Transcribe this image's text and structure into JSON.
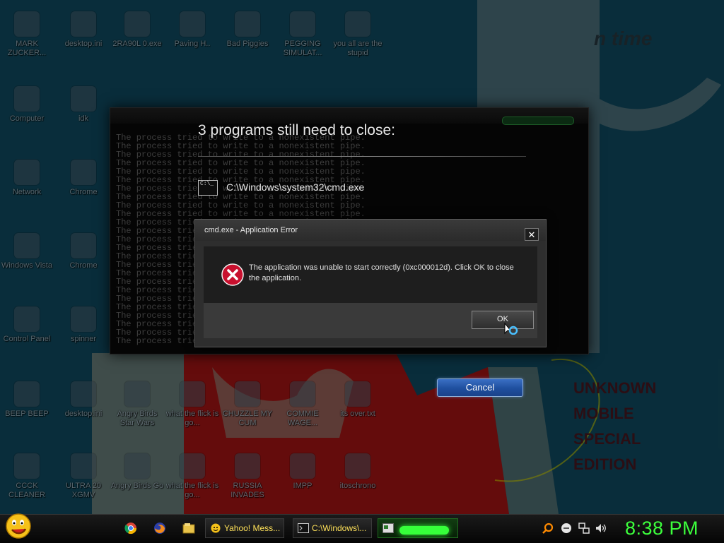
{
  "shutdown": {
    "headline": "3 programs still need to close:",
    "program_name": "C:\\Windows\\system32\\cmd.exe",
    "program_icon_text": "C:\\_",
    "cancel_label": "Cancel"
  },
  "error_dialog": {
    "title": "cmd.exe - Application Error",
    "close_glyph": "✕",
    "message": "The application was unable to start correctly (0xc000012d). Click OK to close the application.",
    "ok_label": "OK",
    "icon": "error-icon"
  },
  "wallpaper": {
    "time_text": "n time",
    "red_caption_lines": [
      "UNKNOWN",
      "MOBILE",
      "SPECIAL",
      "EDITION"
    ]
  },
  "desktop_icons": [
    {
      "label": "MARK ZUCKER..."
    },
    {
      "label": "desktop.ini"
    },
    {
      "label": "2RA90L 0.exe"
    },
    {
      "label": "Paving H.."
    },
    {
      "label": "Bad Piggies"
    },
    {
      "label": "PEGGING SIMULAT..."
    },
    {
      "label": "you all are the stupid"
    },
    {
      "label": "Computer"
    },
    {
      "label": "idk"
    },
    {
      "label": "Network"
    },
    {
      "label": "Chrome"
    },
    {
      "label": "Windows Vista"
    },
    {
      "label": "Chrome"
    },
    {
      "label": "Control Panel"
    },
    {
      "label": "spinner"
    },
    {
      "label": "BEEP BEEP"
    },
    {
      "label": "desktop.ini"
    },
    {
      "label": "Angry Birds Star Wars"
    },
    {
      "label": "what the flick is go..."
    },
    {
      "label": "CHUZZLE MY CUM"
    },
    {
      "label": "COMMIE WAGE..."
    },
    {
      "label": "its over.txt"
    },
    {
      "label": "CCCK CLEANER"
    },
    {
      "label": "ULTRA 20 XGMV"
    },
    {
      "label": "Angry Birds Go"
    },
    {
      "label": "what the flick is go..."
    },
    {
      "label": "RUSSIA INVADES"
    },
    {
      "label": "IMPP"
    },
    {
      "label": "itoschrono"
    }
  ],
  "console_line": "The process tried to write to a nonexistent pipe.",
  "taskbar": {
    "start_icon": "smiley-start-icon",
    "pinned": [
      {
        "name": "chrome-icon"
      },
      {
        "name": "firefox-icon"
      },
      {
        "name": "folder-icon"
      }
    ],
    "tasks": [
      {
        "label": "Yahoo! Mess...",
        "icon": "yahoo-messenger-icon"
      },
      {
        "label": "C:\\Windows\\...",
        "icon": "cmd-icon"
      },
      {
        "label": "",
        "icon": "app-icon"
      }
    ],
    "tray": [
      {
        "name": "search-tray-icon"
      },
      {
        "name": "minus-tray-icon"
      },
      {
        "name": "network-tray-icon"
      },
      {
        "name": "volume-tray-icon"
      }
    ],
    "clock": "8:38 PM"
  },
  "colors": {
    "clock": "#3cff3c",
    "task_label": "#ffe25a",
    "cancel_button": "#1f4f9e"
  }
}
